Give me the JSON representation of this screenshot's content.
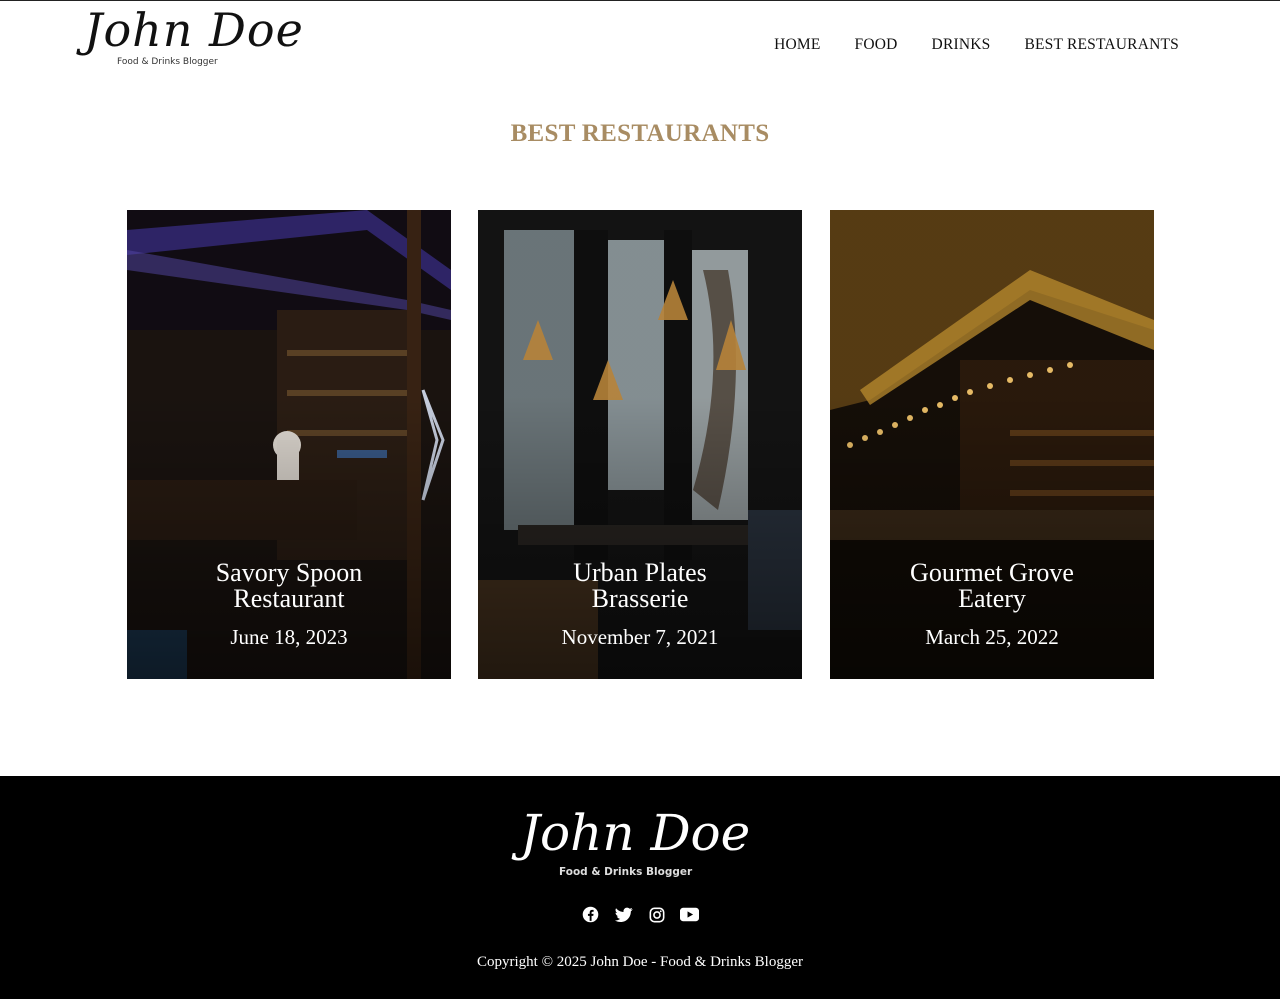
{
  "header": {
    "logo_name": "John Doe",
    "logo_tagline": "Food & Drinks Blogger",
    "nav": [
      "HOME",
      "FOOD",
      "DRINKS",
      "BEST RESTAURANTS"
    ]
  },
  "section": {
    "title": "BEST RESTAURANTS"
  },
  "cards": [
    {
      "name_line1": "Savory Spoon",
      "name_line2": "Restaurant",
      "date": "June 18, 2023"
    },
    {
      "name_line1": "Urban Plates",
      "name_line2": "Brasserie",
      "date": "November 7, 2021"
    },
    {
      "name_line1": "Gourmet Grove",
      "name_line2": "Eatery",
      "date": "March 25, 2022"
    }
  ],
  "footer": {
    "logo_name": "John Doe",
    "logo_tagline": "Food & Drinks Blogger",
    "social_icons": [
      "facebook-icon",
      "twitter-icon",
      "instagram-icon",
      "youtube-icon"
    ],
    "copyright": "Copyright © 2025 John Doe - Food & Drinks Blogger"
  },
  "colors": {
    "accent": "#a88c63",
    "footer_bg": "#000000"
  }
}
